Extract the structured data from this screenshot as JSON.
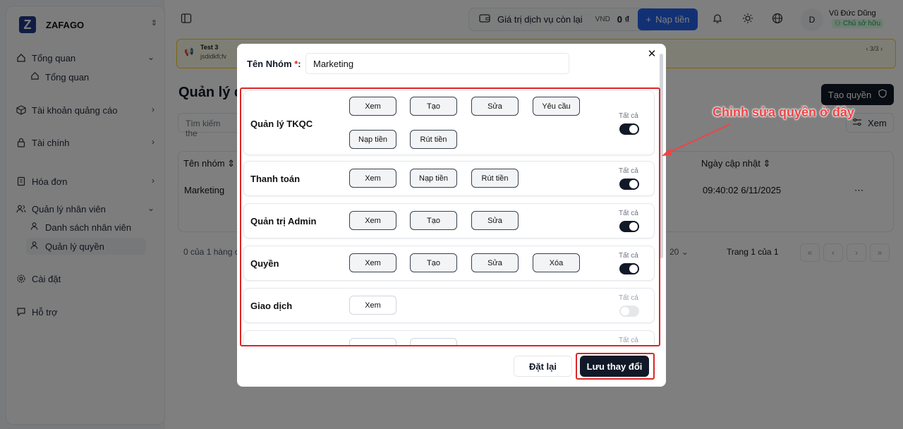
{
  "brand": {
    "name": "ZAFAGO",
    "logo_letter": "Z"
  },
  "sidebar": {
    "items": [
      {
        "label": "Tổng quan",
        "icon": "home-icon"
      },
      {
        "label": "Tổng quan",
        "icon": "home-icon",
        "sub": true
      },
      {
        "label": "Tài khoản quảng cáo",
        "icon": "box-icon"
      },
      {
        "label": "Tài chính",
        "icon": "lock-icon"
      },
      {
        "label": "Hóa đơn",
        "icon": "receipt-icon"
      },
      {
        "label": "Quản lý nhân viên",
        "icon": "users-icon"
      },
      {
        "label": "Danh sách nhân viên",
        "icon": "user-icon",
        "sub": true
      },
      {
        "label": "Quản lý quyền",
        "icon": "user-icon",
        "sub": true
      },
      {
        "label": "Cài đặt",
        "icon": "gear-icon"
      },
      {
        "label": "Hỗ trợ",
        "icon": "chat-icon"
      }
    ]
  },
  "topbar": {
    "balance_label": "Giá trị dịch vụ còn lại",
    "currency": "VND",
    "balance": "0 ₫",
    "topup_label": "Nạp tiền",
    "avatar_letter": "D",
    "user_name": "Vũ Đức Dũng",
    "user_role": "Chủ sở hữu"
  },
  "notice": {
    "title": "Test 3",
    "text": "jsdidkfi;fv",
    "pager": "3/3"
  },
  "page": {
    "title": "Quản lý q",
    "create_label": "Tạo quyền",
    "search_placeholder": "Tìm kiếm the",
    "view_label": "Xem",
    "col_name": "Tên nhóm",
    "col_updated": "Ngày cập nhật",
    "row_name": "Marketing",
    "row_updated": "09:40:02 6/11/2025",
    "row_menu": "⋯",
    "footer_count": "0 của 1 hàng c",
    "page_size": "20",
    "page_info": "Trang 1 của 1"
  },
  "modal": {
    "name_label": "Tên Nhóm",
    "required_mark": "*",
    "colon": ":",
    "name_value": "Marketing",
    "all_label": "Tất cả",
    "groups": [
      {
        "title": "Quản lý TKQC",
        "perms": [
          "Xem",
          "Tạo",
          "Sửa",
          "Yêu cầu",
          "Nạp tiền",
          "Rút tiền"
        ],
        "all": true
      },
      {
        "title": "Thanh toán",
        "perms": [
          "Xem",
          "Nạp tiền",
          "Rút tiền"
        ],
        "all": true
      },
      {
        "title": "Quản trị Admin",
        "perms": [
          "Xem",
          "Tạo",
          "Sửa"
        ],
        "all": true
      },
      {
        "title": "Quyền",
        "perms": [
          "Xem",
          "Tạo",
          "Sửa",
          "Xóa"
        ],
        "all": true
      },
      {
        "title": "Giao dịch",
        "perms": [
          "Xem"
        ],
        "all": false
      }
    ],
    "reset_label": "Đặt lại",
    "save_label": "Lưu thay đổi"
  },
  "annotation": {
    "text": "Chỉnh sửa quyền ở đây",
    "color": "#ef4444"
  }
}
